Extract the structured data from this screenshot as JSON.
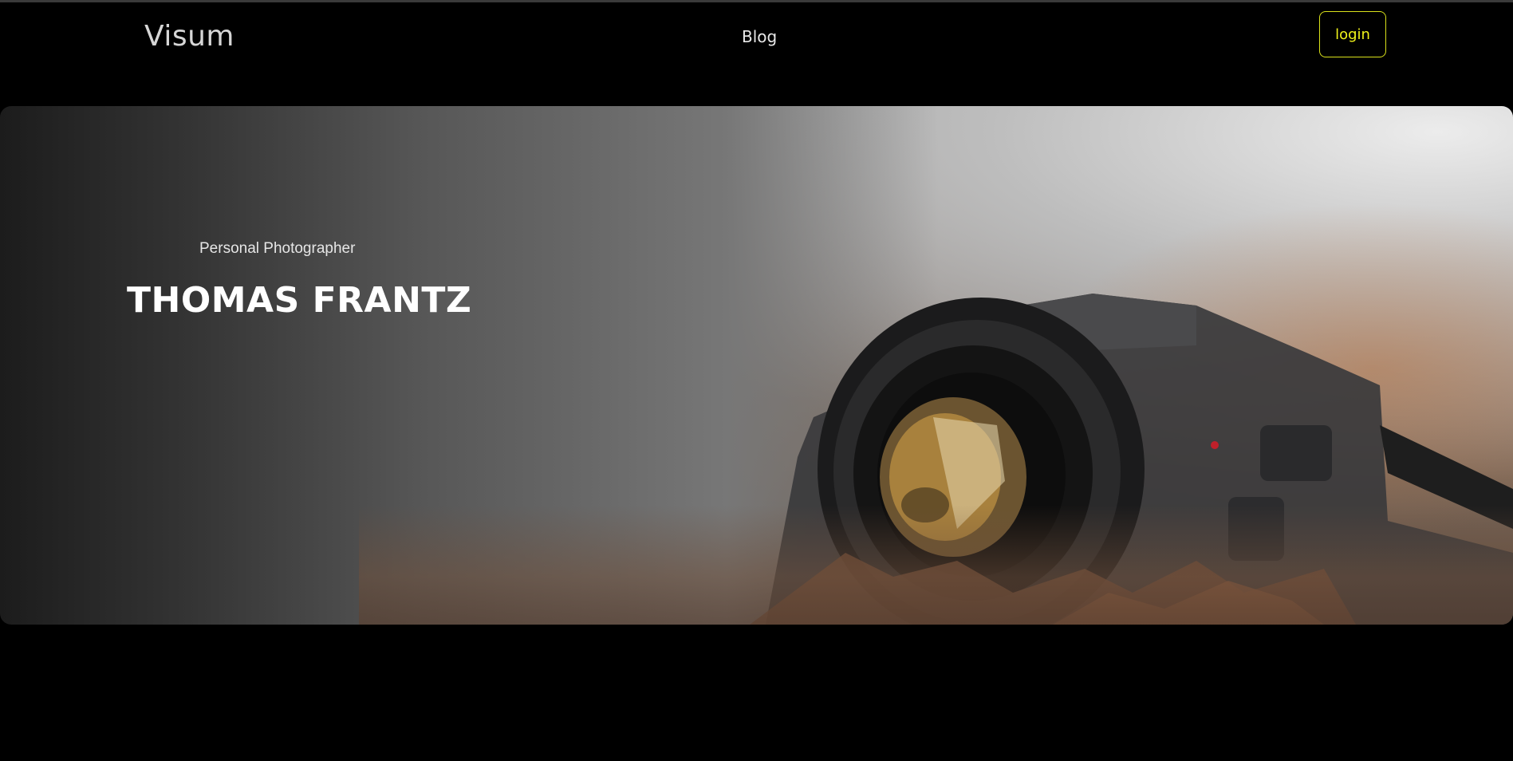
{
  "header": {
    "logo": "Visum",
    "nav": [
      {
        "label": "Blog"
      }
    ],
    "login_label": "login"
  },
  "hero": {
    "subtitle": "Personal Photographer",
    "title": "THOMAS FRANTZ"
  },
  "colors": {
    "background": "#000000",
    "accent": "#f0f21a",
    "text": "#e6e6e6"
  }
}
